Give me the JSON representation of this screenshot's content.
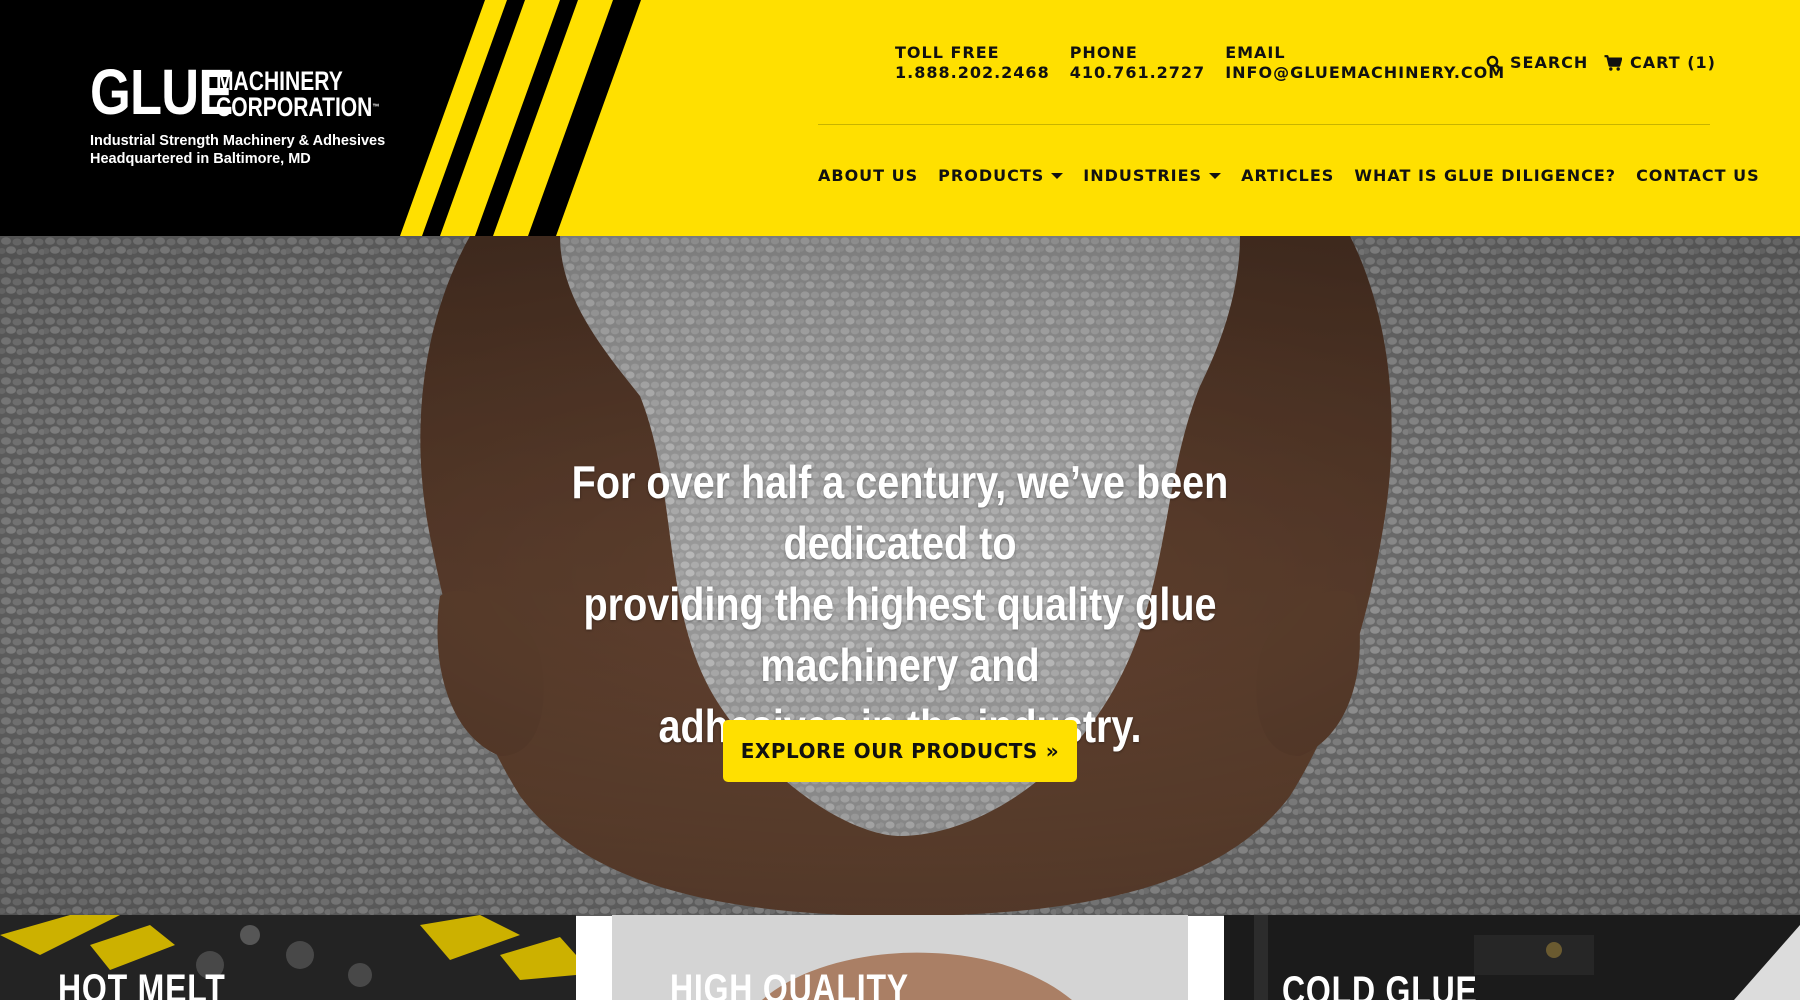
{
  "brand": {
    "glue": "GLUE",
    "line1": "MACHINERY",
    "line2": "CORPORATION",
    "tm": "™",
    "tagline1": "Industrial Strength Machinery & Adhesives",
    "tagline2": "Headquartered in Baltimore, MD"
  },
  "contact": {
    "toll_free_label": "TOLL FREE",
    "toll_free_value": "1.888.202.2468",
    "phone_label": "PHONE",
    "phone_value": "410.761.2727",
    "email_label": "EMAIL",
    "email_value": "INFO@GLUEMACHINERY.COM"
  },
  "utility": {
    "search_label": "SEARCH",
    "cart_label": "CART (1)"
  },
  "nav": {
    "about": "ABOUT US",
    "products": "PRODUCTS",
    "industries": "INDUSTRIES",
    "articles": "ARTICLES",
    "diligence": "WHAT IS GLUE DILIGENCE?",
    "contact": "CONTACT US"
  },
  "hero": {
    "line1": "For over half a century, we’ve been dedicated to",
    "line2": "providing the highest quality glue machinery and",
    "line3": "adhesives in the industry.",
    "cta_label": "EXPLORE OUR PRODUCTS",
    "cta_icon": "»"
  },
  "cards": {
    "card1_title": "HOT MELT",
    "card2_title": "HIGH QUALITY",
    "card3_title": "COLD GLUE"
  },
  "colors": {
    "brand_yellow": "#FFE000",
    "brand_black": "#111111"
  }
}
